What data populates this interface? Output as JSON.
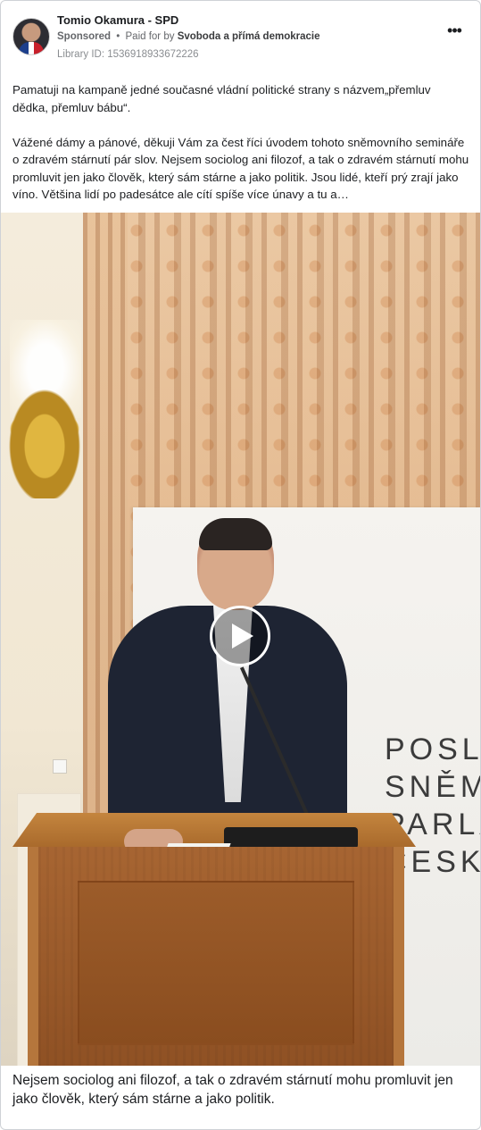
{
  "header": {
    "page_name": "Tomio Okamura - SPD",
    "sponsored_label": "Sponsored",
    "separator": "•",
    "paid_for_prefix": "Paid for by",
    "payer": "Svoboda a přímá demokracie",
    "library_id": "Library ID: 1536918933672226",
    "more_icon": "more-horizontal-icon"
  },
  "body": {
    "paragraph_1": "Pamatuji na kampaně jedné současné vládní politické strany s názvem„přemluv dědka, přemluv bábu“.",
    "paragraph_2": "Vážené dámy a pánové, děkuji Vám za čest říci úvodem tohoto sněmovního semináře o zdravém stárnutí pár slov. Nejsem sociolog ani filozof, a tak o zdravém stárnutí mohu promluvit jen jako člověk, který sám stárne a jako politik. Jsou lidé, kteří prý zrají jako víno. Většina lidí po padesátce ale cítí spíše více únavy a tu a…"
  },
  "media": {
    "type": "video",
    "play_icon": "play-icon",
    "banner_lines": [
      "POSLA",
      "SNĚM",
      "PARLA",
      "ČESKÉ"
    ]
  },
  "caption": "Nejsem sociolog ani filozof, a tak o zdravém stárnutí mohu promluvit jen jako člověk, který sám stárne a jako politik."
}
